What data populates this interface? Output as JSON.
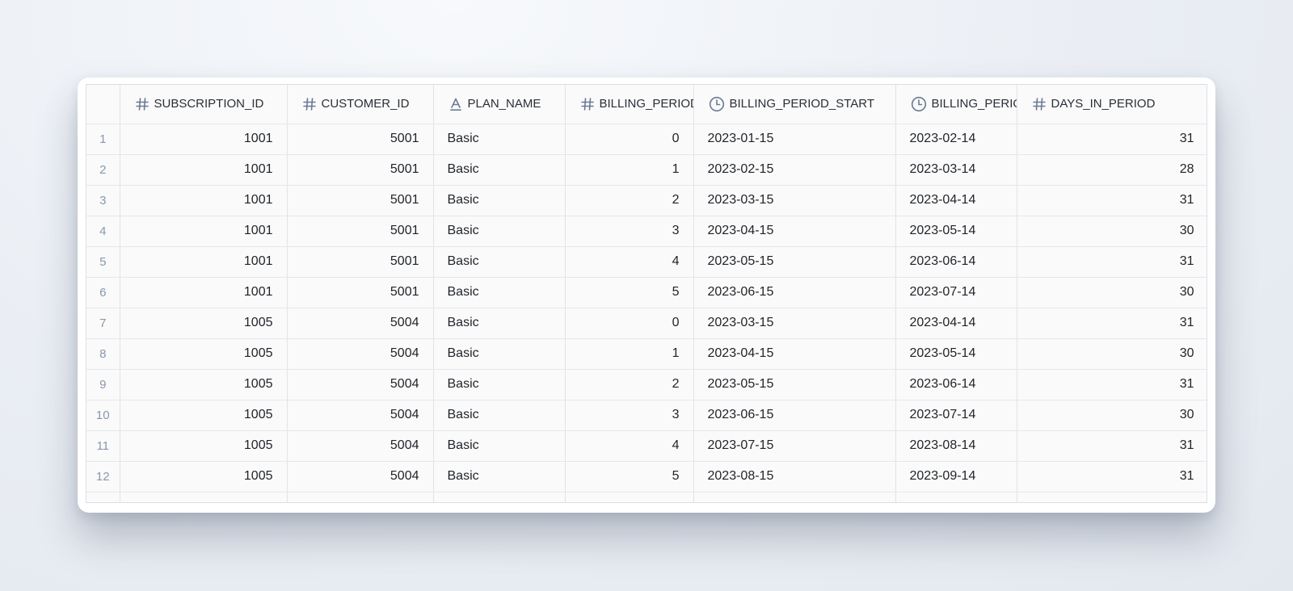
{
  "columns": [
    {
      "label": "SUBSCRIPTION_ID",
      "icon": "hash-icon"
    },
    {
      "label": "CUSTOMER_ID",
      "icon": "hash-icon"
    },
    {
      "label": "PLAN_NAME",
      "icon": "text-type-icon"
    },
    {
      "label": "BILLING_PERIOD_",
      "icon": "hash-icon"
    },
    {
      "label": "BILLING_PERIOD_START",
      "icon": "clock-icon"
    },
    {
      "label": "BILLING_PERIOD",
      "icon": "clock-icon"
    },
    {
      "label": "DAYS_IN_PERIOD",
      "icon": "hash-icon"
    }
  ],
  "rows": [
    {
      "n": "1",
      "sub": "1001",
      "cust": "5001",
      "plan": "Basic",
      "bp": "0",
      "start": "2023-01-15",
      "end": "2023-02-14",
      "days": "31"
    },
    {
      "n": "2",
      "sub": "1001",
      "cust": "5001",
      "plan": "Basic",
      "bp": "1",
      "start": "2023-02-15",
      "end": "2023-03-14",
      "days": "28"
    },
    {
      "n": "3",
      "sub": "1001",
      "cust": "5001",
      "plan": "Basic",
      "bp": "2",
      "start": "2023-03-15",
      "end": "2023-04-14",
      "days": "31"
    },
    {
      "n": "4",
      "sub": "1001",
      "cust": "5001",
      "plan": "Basic",
      "bp": "3",
      "start": "2023-04-15",
      "end": "2023-05-14",
      "days": "30"
    },
    {
      "n": "5",
      "sub": "1001",
      "cust": "5001",
      "plan": "Basic",
      "bp": "4",
      "start": "2023-05-15",
      "end": "2023-06-14",
      "days": "31"
    },
    {
      "n": "6",
      "sub": "1001",
      "cust": "5001",
      "plan": "Basic",
      "bp": "5",
      "start": "2023-06-15",
      "end": "2023-07-14",
      "days": "30"
    },
    {
      "n": "7",
      "sub": "1005",
      "cust": "5004",
      "plan": "Basic",
      "bp": "0",
      "start": "2023-03-15",
      "end": "2023-04-14",
      "days": "31"
    },
    {
      "n": "8",
      "sub": "1005",
      "cust": "5004",
      "plan": "Basic",
      "bp": "1",
      "start": "2023-04-15",
      "end": "2023-05-14",
      "days": "30"
    },
    {
      "n": "9",
      "sub": "1005",
      "cust": "5004",
      "plan": "Basic",
      "bp": "2",
      "start": "2023-05-15",
      "end": "2023-06-14",
      "days": "31"
    },
    {
      "n": "10",
      "sub": "1005",
      "cust": "5004",
      "plan": "Basic",
      "bp": "3",
      "start": "2023-06-15",
      "end": "2023-07-14",
      "days": "30"
    },
    {
      "n": "11",
      "sub": "1005",
      "cust": "5004",
      "plan": "Basic",
      "bp": "4",
      "start": "2023-07-15",
      "end": "2023-08-14",
      "days": "31"
    },
    {
      "n": "12",
      "sub": "1005",
      "cust": "5004",
      "plan": "Basic",
      "bp": "5",
      "start": "2023-08-15",
      "end": "2023-09-14",
      "days": "31"
    }
  ],
  "colors": {
    "icon": "#6b7a94",
    "row_index": "#8a97ad",
    "grid": "#dfe3ea"
  }
}
